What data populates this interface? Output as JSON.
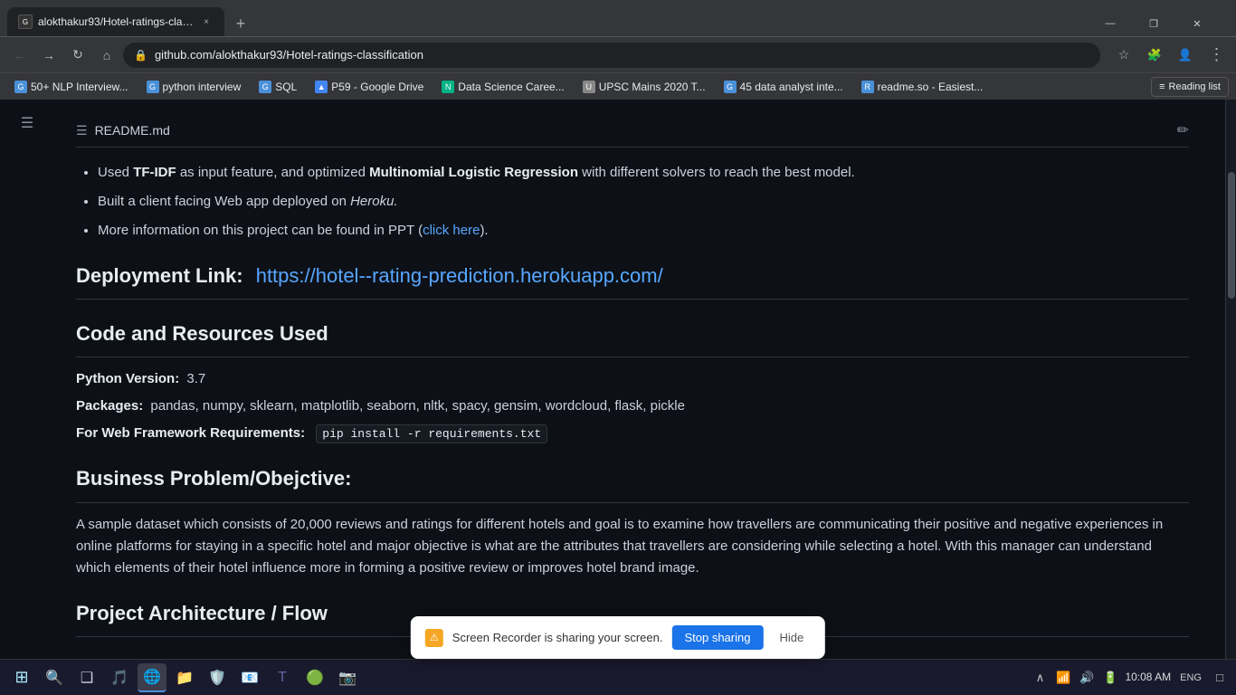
{
  "browser": {
    "tab": {
      "favicon_alt": "github-favicon",
      "title": "alokthakur93/Hotel-ratings-class...",
      "close_label": "×"
    },
    "new_tab_label": "+",
    "address": "github.com/alokthakur93/Hotel-ratings-classification",
    "win_controls": {
      "minimize": "—",
      "maximize": "❐",
      "close": "✕"
    },
    "nav": {
      "back": "←",
      "forward": "→",
      "refresh": "↻",
      "home": "⌂"
    },
    "toolbar_icons": {
      "star": "☆",
      "extension1": "🧩",
      "extension2": "🌐",
      "profile": "👤",
      "menu": "⋮"
    }
  },
  "bookmarks": [
    {
      "id": "nlp",
      "favicon_color": "#4a90d9",
      "label": "50+ NLP Interview..."
    },
    {
      "id": "python",
      "favicon_color": "#4a90d9",
      "label": "python interview"
    },
    {
      "id": "sql",
      "favicon_color": "#4a90d9",
      "label": "SQL"
    },
    {
      "id": "p59",
      "favicon_color": "#4285f4",
      "label": "P59 - Google Drive"
    },
    {
      "id": "datasci",
      "favicon_color": "#00b386",
      "label": "Data Science Caree..."
    },
    {
      "id": "upsc",
      "favicon_color": "#888",
      "label": "UPSC Mains 2020 T..."
    },
    {
      "id": "analyst",
      "favicon_color": "#4a90d9",
      "label": "45 data analyst inte..."
    },
    {
      "id": "readme",
      "favicon_color": "#4a90d9",
      "label": "readme.so - Easiest..."
    },
    {
      "id": "reading",
      "favicon_color": "#888",
      "label": "Reading list"
    }
  ],
  "readme": {
    "title": "README.md",
    "edit_icon": "✏",
    "bullets": [
      "Used <strong>TF-IDF</strong> as input feature, and optimized <strong>Multinomial Logistic Regression</strong> with different solvers to reach the best model.",
      "Built a client facing Web app deployed on <em>Heroku</em>.",
      "More information on this project can be found in PPT (<a>click here</a>)."
    ],
    "deployment_heading": "Deployment Link:",
    "deployment_url": "https://hotel--rating-prediction.herokuapp.com/",
    "code_resources_heading": "Code and Resources Used",
    "python_version_label": "Python Version:",
    "python_version_value": "3.7",
    "packages_label": "Packages:",
    "packages_value": "pandas, numpy, sklearn, matplotlib, seaborn, nltk, spacy, gensim, wordcloud, flask, pickle",
    "web_framework_label": "For Web Framework Requirements:",
    "web_framework_code": "pip install -r requirements.txt",
    "business_heading": "Business Problem/Obejctive:",
    "business_text": "A sample dataset which consists of 20,000 reviews and ratings for different hotels and goal is to examine how travellers are communicating their positive and negative experiences in online platforms for staying in a specific hotel and major objective is what are the attributes that travellers are considering while selecting a hotel. With this manager can understand which elements of their hotel influence more in forming a positive review or improves hotel brand image.",
    "architecture_heading": "Project Architecture / Flow"
  },
  "screen_share": {
    "icon": "📺",
    "text": "Screen Recorder is sharing your screen.",
    "stop_label": "Stop sharing",
    "hide_label": "Hide"
  },
  "taskbar": {
    "clock_time": "10:08 AM",
    "lang": "ENG",
    "icons": [
      "⊞",
      "🔍",
      "❑",
      "🎵",
      "🌐",
      "📁",
      "🛡️",
      "📧",
      "🔷",
      "🟢",
      "📷"
    ]
  }
}
